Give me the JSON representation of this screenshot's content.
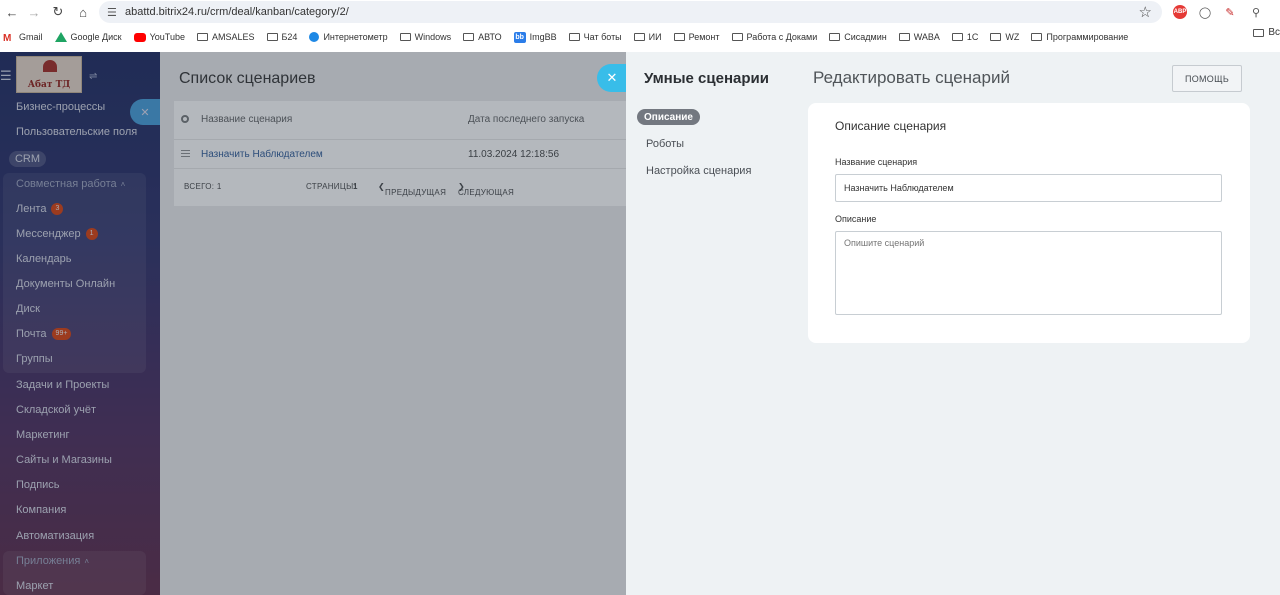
{
  "browser": {
    "url": "abattd.bitrix24.ru/crm/deal/kanban/category/2/",
    "bookmarks": [
      {
        "label": "Gmail",
        "icon": "gmail-icon"
      },
      {
        "label": "Google Диск",
        "icon": "google-drive-icon"
      },
      {
        "label": "YouTube",
        "icon": "youtube-icon"
      },
      {
        "label": "AMSALES",
        "icon": "folder-icon"
      },
      {
        "label": "Б24",
        "icon": "folder-icon"
      },
      {
        "label": "Интернетометр",
        "icon": "speedometer-icon"
      },
      {
        "label": "Windows",
        "icon": "folder-icon"
      },
      {
        "label": "АВТО",
        "icon": "folder-icon"
      },
      {
        "label": "ImgBB",
        "icon": "imgbb-icon"
      },
      {
        "label": "Чат боты",
        "icon": "folder-icon"
      },
      {
        "label": "ИИ",
        "icon": "folder-icon"
      },
      {
        "label": "Ремонт",
        "icon": "folder-icon"
      },
      {
        "label": "Работа с Доками",
        "icon": "folder-icon"
      },
      {
        "label": "Сисадмин",
        "icon": "folder-icon"
      },
      {
        "label": "WABA",
        "icon": "folder-icon"
      },
      {
        "label": "1С",
        "icon": "folder-icon"
      },
      {
        "label": "WZ",
        "icon": "folder-icon"
      },
      {
        "label": "Программирование",
        "icon": "folder-icon"
      }
    ],
    "bookmarks_more": "Вс",
    "abp_label": "ABP"
  },
  "sidebar": {
    "logo_text": "Абат ТД",
    "items": [
      {
        "label": "Бизнес-процессы"
      },
      {
        "label": "Пользовательские поля"
      },
      {
        "label": "CRM"
      },
      {
        "label": "Совместная работа"
      },
      {
        "label": "Лента",
        "badge": "3"
      },
      {
        "label": "Мессенджер",
        "badge": "1"
      },
      {
        "label": "Календарь"
      },
      {
        "label": "Документы Онлайн"
      },
      {
        "label": "Диск"
      },
      {
        "label": "Почта",
        "badge": "99+"
      },
      {
        "label": "Группы"
      },
      {
        "label": "Задачи и Проекты"
      },
      {
        "label": "Складской учёт"
      },
      {
        "label": "Маркетинг"
      },
      {
        "label": "Сайты и Магазины"
      },
      {
        "label": "Подпись"
      },
      {
        "label": "Компания"
      },
      {
        "label": "Автоматизация"
      },
      {
        "label": "Приложения"
      },
      {
        "label": "Маркет"
      }
    ]
  },
  "main": {
    "title": "Список сценариев",
    "columns": [
      "Название сценария",
      "Дата последнего запуска"
    ],
    "rows": [
      {
        "name": "Назначить Наблюдателем",
        "date": "11.03.2024 12:18:56"
      }
    ],
    "footer": {
      "total": "ВСЕГО: 1",
      "pages": "СТРАНИЦЫ:",
      "page_num": "1",
      "prev": "ПРЕДЫДУЩАЯ",
      "next": "СЛЕДУЮЩАЯ"
    }
  },
  "panel": {
    "title": "Умные сценарии",
    "nav": [
      "Описание",
      "Роботы",
      "Настройка сценария"
    ],
    "edit_title": "Редактировать сценарий",
    "help_button": "ПОМОЩЬ",
    "card": {
      "title": "Описание сценария",
      "name_label": "Название сценария",
      "name_value": "Назначить Наблюдателем",
      "desc_label": "Описание",
      "desc_placeholder": "Опишите сценарий"
    }
  },
  "colors": {
    "accent": "#38bde9",
    "badge": "#e8501b",
    "panel_bg": "#eef2f4"
  }
}
